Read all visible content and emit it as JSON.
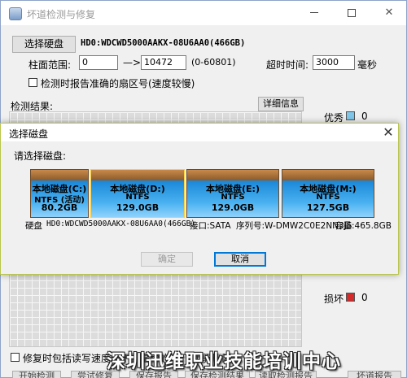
{
  "window": {
    "title": "坏道检测与修复"
  },
  "toolbar": {
    "select_disk_label": "选择硬盘",
    "disk_name": "HD0:WDCWD5000AAKX-08U6AA0(466GB)"
  },
  "cylinder": {
    "label": "柱面范围:",
    "from_value": "0",
    "arrow": "—>",
    "to_value": "10472",
    "range_hint": "(0-60801)"
  },
  "timeout": {
    "label": "超时时间:",
    "value": "3000",
    "unit": "毫秒"
  },
  "options": {
    "report_sector_label": "检测时报告准确的扇区号(速度较慢)",
    "repair_option_label": "修复时包括读写速度慢于此毫秒的(剩下步骤删除)"
  },
  "results": {
    "label": "检测结果:",
    "detail_button": "详细信息"
  },
  "legend": {
    "good": {
      "label": "优秀",
      "count": "0",
      "color": "#7fc6e8"
    },
    "bad": {
      "label": "损坏",
      "count": "0",
      "color": "#d42a2a"
    }
  },
  "watermark": "深圳迅维职业技能培训中心",
  "bottom_buttons": [
    "开始检测",
    "尝试修复",
    "保存报告",
    "保存检测结果",
    "读取检测报告",
    "坏道报告"
  ],
  "dialog": {
    "title": "选择磁盘",
    "prompt": "请选择磁盘:",
    "disks": [
      {
        "name": "本地磁盘(C:)",
        "fs": "NTFS (活动)",
        "size": "80.2GB"
      },
      {
        "name": "本地磁盘(D:)",
        "fs": "NTFS",
        "size": "129.0GB"
      },
      {
        "name": "本地磁盘(E:)",
        "fs": "NTFS",
        "size": "129.0GB"
      },
      {
        "name": "本地磁盘(M:)",
        "fs": "NTFS",
        "size": "127.5GB"
      }
    ],
    "disk_info": {
      "disk_label": "硬盘",
      "disk_model": "HD0:WDCWD5000AAKX-08U6AA0(466GB)",
      "interface": "接口:SATA",
      "serial": "序列号:W-DMW2C0E2NN3JS",
      "capacity": "容量:465.8GB"
    },
    "ok_label": "确定",
    "cancel_label": "取消"
  }
}
